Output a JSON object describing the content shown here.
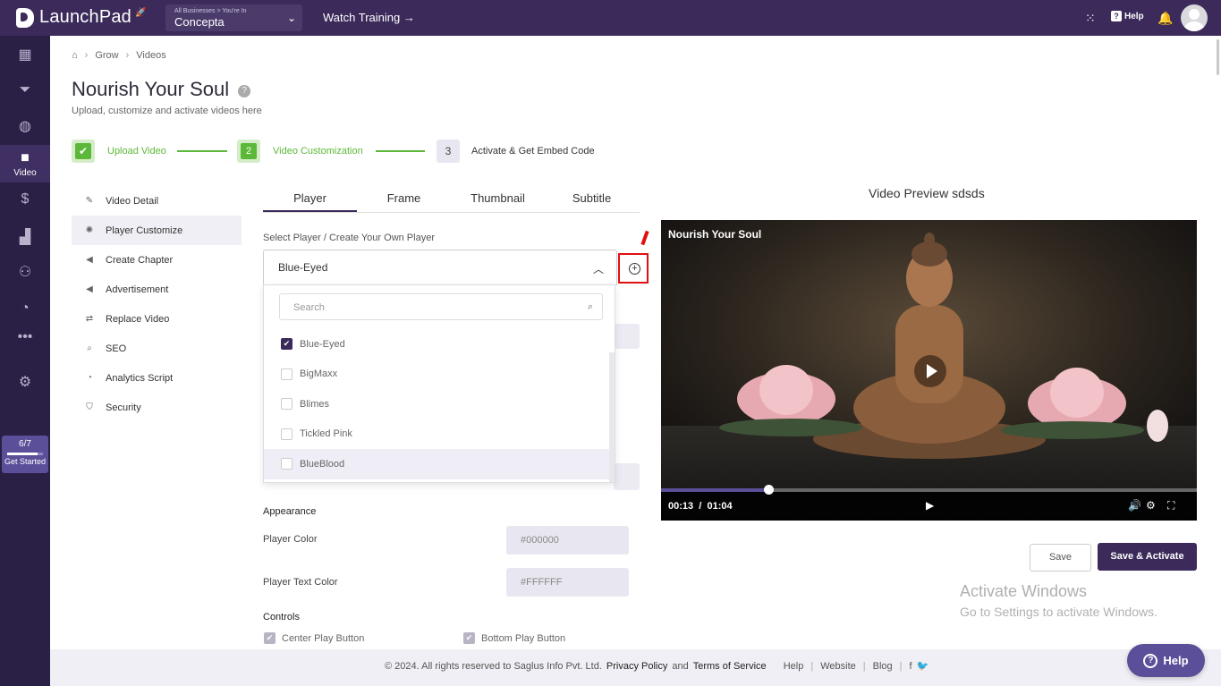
{
  "topbar": {
    "logo": "LaunchPad",
    "business_caption": "All Businesses > You're In",
    "business_name": "Concepta",
    "watch_training": "Watch Training →",
    "help": "Help"
  },
  "rail": {
    "active_label": "Video",
    "get_started_fraction": "6/7",
    "get_started_label": "Get Started",
    "get_started_progress": 0.857
  },
  "breadcrumb": {
    "items": [
      "Grow",
      "Videos"
    ]
  },
  "page": {
    "title": "Nourish Your Soul",
    "subtitle": "Upload, customize and activate videos here"
  },
  "stepper": {
    "steps": [
      {
        "label": "Upload Video",
        "state": "done"
      },
      {
        "num": "2",
        "label": "Video Customization",
        "state": "current"
      },
      {
        "num": "3",
        "label": "Activate & Get Embed Code",
        "state": "todo"
      }
    ]
  },
  "sidemenu": {
    "items": [
      {
        "label": "Video Detail"
      },
      {
        "label": "Player Customize"
      },
      {
        "label": "Create Chapter"
      },
      {
        "label": "Advertisement"
      },
      {
        "label": "Replace Video"
      },
      {
        "label": "SEO"
      },
      {
        "label": "Analytics Script"
      },
      {
        "label": "Security"
      }
    ]
  },
  "tabs": [
    "Player",
    "Frame",
    "Thumbnail",
    "Subtitle"
  ],
  "player_select": {
    "label": "Select Player / Create Your Own Player",
    "selected": "Blue-Eyed",
    "search_placeholder": "Search",
    "options": [
      "Blue-Eyed",
      "BigMaxx",
      "Blimes",
      "Tickled Pink",
      "BlueBlood"
    ]
  },
  "appearance": {
    "heading": "Appearance",
    "player_color_label": "Player Color",
    "player_color_value": "#000000",
    "player_text_color_label": "Player Text Color",
    "player_text_color_value": "#FFFFFF"
  },
  "controls": {
    "heading": "Controls",
    "center_play": "Center Play Button",
    "bottom_play": "Bottom Play Button"
  },
  "preview": {
    "heading": "Video Preview sdsds",
    "video_title": "Nourish Your Soul",
    "current_time": "00:13",
    "separator": "/",
    "duration": "01:04",
    "progress": 0.2
  },
  "actions": {
    "save": "Save",
    "save_activate": "Save & Activate"
  },
  "watermark": {
    "line1": "Activate Windows",
    "line2": "Go to Settings to activate Windows."
  },
  "footer": {
    "copyright": "©  2024. All rights reserved to Saglus Info Pvt. Ltd.",
    "privacy": "Privacy Policy",
    "and": "and",
    "terms": "Terms of Service",
    "help": "Help",
    "website": "Website",
    "blog": "Blog"
  },
  "help_button": "Help",
  "colors": {
    "brand": "#3b2a5a",
    "success": "#5cb838",
    "highlight": "#e01010"
  }
}
